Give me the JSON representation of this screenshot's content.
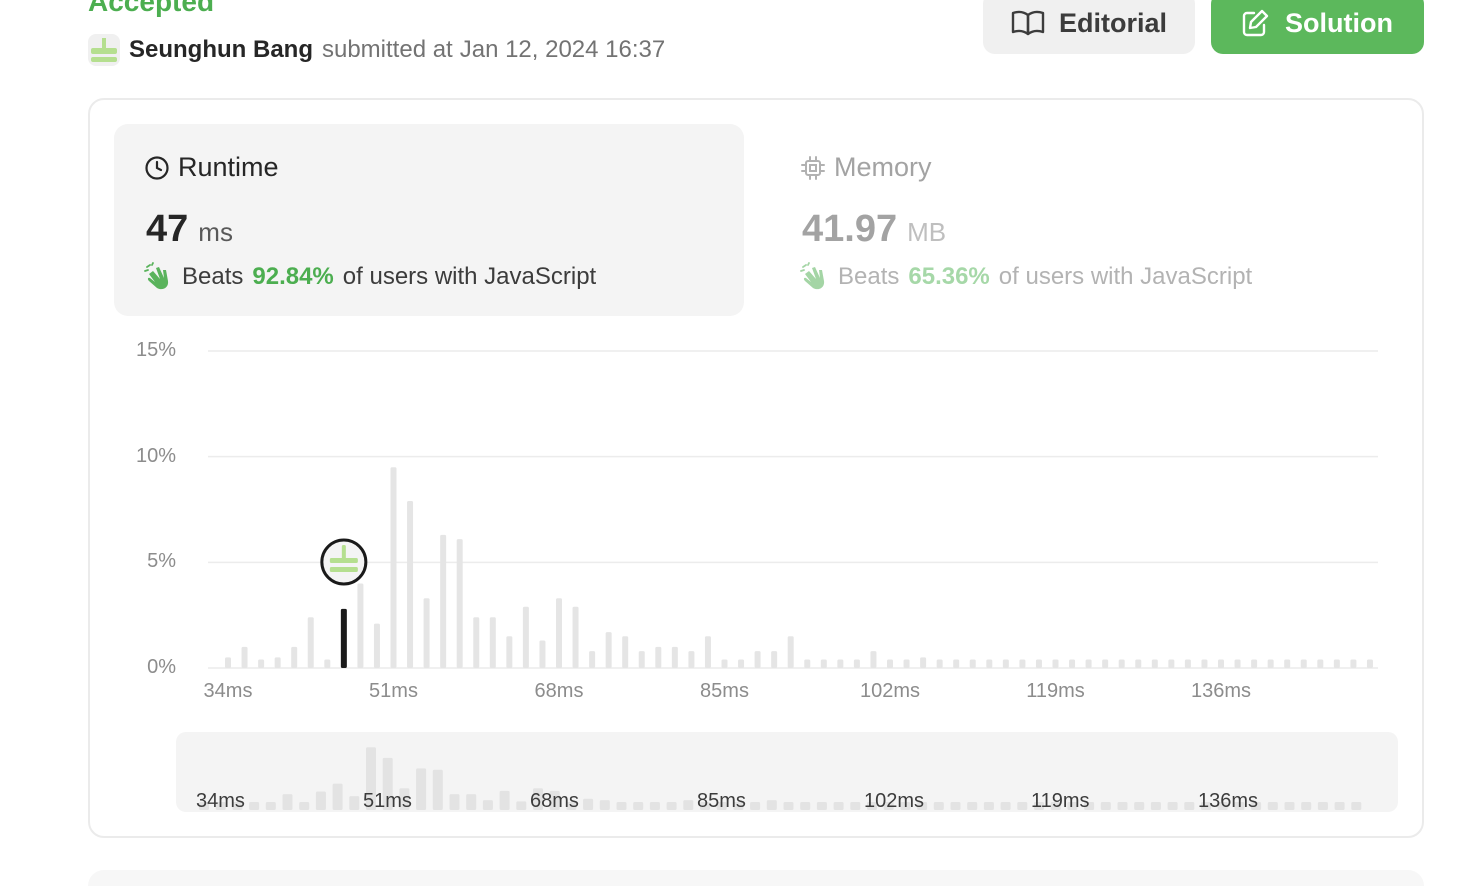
{
  "submission": {
    "status": "Accepted",
    "user_name": "Seunghun Bang",
    "submitted_text": "submitted at",
    "submitted_time": "Jan 12, 2024 16:37"
  },
  "buttons": {
    "editorial": "Editorial",
    "solution": "Solution"
  },
  "colors": {
    "accepted_green": "#4cae50",
    "solution_button": "#5cb85c",
    "bar_gray": "#e5e5e5",
    "selected_bar": "#1a1a1a"
  },
  "icons": {
    "editorial": "open-book-icon",
    "solution": "edit-note-icon",
    "runtime": "clock-icon",
    "memory": "chip-icon",
    "beats": "clapping-hands-icon"
  },
  "runtime": {
    "label": "Runtime",
    "value": "47",
    "unit": "ms",
    "beats_label": "Beats",
    "beats_pct": "92.84%",
    "beats_tail": "of users with JavaScript"
  },
  "memory": {
    "label": "Memory",
    "value": "41.97",
    "unit": "MB",
    "beats_label": "Beats",
    "beats_pct": "65.36%",
    "beats_tail": "of users with JavaScript"
  },
  "chart_data": {
    "type": "bar",
    "ylabel_ticks": [
      "0%",
      "5%",
      "10%",
      "15%"
    ],
    "ylim": [
      0,
      15
    ],
    "x_tick_labels": [
      "34ms",
      "51ms",
      "68ms",
      "85ms",
      "102ms",
      "119ms",
      "136ms"
    ],
    "x_tick_values": [
      34,
      51,
      68,
      85,
      102,
      119,
      136
    ],
    "x_start": 34,
    "x_step": 1.7,
    "grid": true,
    "selected_index": 7,
    "selected_value_label": "47 ms",
    "values": [
      0.5,
      1.0,
      0.4,
      0.5,
      1.0,
      2.4,
      0.4,
      2.8,
      4.0,
      2.1,
      9.5,
      7.9,
      3.3,
      6.3,
      6.1,
      2.4,
      2.4,
      1.5,
      2.9,
      1.3,
      3.3,
      2.9,
      0.8,
      1.7,
      1.5,
      0.8,
      1.0,
      1.0,
      0.8,
      1.5,
      0.4,
      0.4,
      0.8,
      0.8,
      1.5,
      0.4,
      0.4,
      0.4,
      0.4,
      0.8,
      0.4,
      0.4,
      0.5,
      0.4,
      0.4,
      0.4,
      0.4,
      0.4,
      0.4,
      0.4,
      0.4,
      0.4,
      0.4,
      0.4,
      0.4,
      0.4,
      0.4,
      0.4,
      0.4,
      0.4,
      0.4,
      0.4,
      0.4,
      0.4,
      0.4,
      0.4,
      0.4,
      0.4,
      0.4,
      0.4
    ]
  }
}
